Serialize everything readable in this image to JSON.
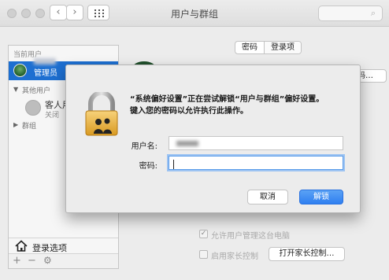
{
  "window": {
    "title": "用户与群组",
    "back_glyph": "‹",
    "forward_glyph": "›",
    "search_glyph": "⌕"
  },
  "tabs": [
    {
      "label": "密码"
    },
    {
      "label": "登录项"
    }
  ],
  "sidebar": {
    "current_users_header": "当前用户",
    "admin_label": "管理员",
    "other_users_header": "其他用户",
    "guest_name": "客人用户",
    "guest_status": "关闭",
    "groups_header": "群组",
    "login_options": "登录选项",
    "add_glyph": "+",
    "remove_glyph": "−",
    "gear_glyph": "⚙"
  },
  "background": {
    "change_password_button": "码…",
    "allow_admin_label": "允许用户管理这台电脑",
    "allow_admin_checked": true,
    "parental_label": "启用家长控制",
    "parental_checked": false,
    "open_parental_button": "打开家长控制…"
  },
  "dialog": {
    "title": "“系统偏好设置”正在尝试解锁“用户与群组”偏好设置。",
    "subtitle": "键入您的密码以允许执行此操作。",
    "username_label": "用户名:",
    "username_value": "",
    "password_label": "密码:",
    "password_value": "",
    "cancel_label": "取消",
    "unlock_label": "解锁"
  },
  "colors": {
    "accent": "#2f7ff0",
    "selection": "#1d6fd1"
  }
}
